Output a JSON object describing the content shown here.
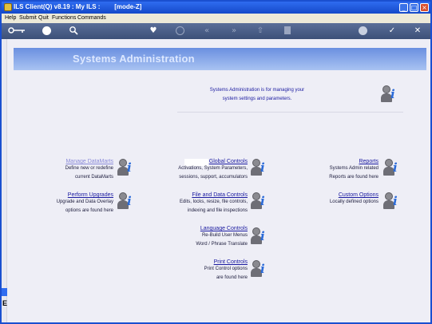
{
  "window": {
    "title": "ILS Client(Q) v8.19 : My ILS :        [mode-Z]",
    "minimize_glyph": "_",
    "maximize_glyph": "□",
    "close_glyph": "×"
  },
  "menu": [
    "Help",
    "Submit",
    "Quit",
    "Functions",
    "Commands"
  ],
  "toolbar": {
    "icons": [
      "key-icon",
      "help-icon",
      "search-icon",
      "heart-icon",
      "refresh-icon",
      "first-icon",
      "last-icon",
      "up-icon",
      "save-icon",
      "settings-icon",
      "confirm-icon",
      "cancel-icon"
    ],
    "glyphs": {
      "help": "?",
      "first": "«",
      "last": "»",
      "up": "⇧",
      "confirm": "✓",
      "cancel": "✕",
      "heart": "♥"
    }
  },
  "banner": {
    "title": "Systems Administration"
  },
  "intro": {
    "line1": "Systems Administration is for managing your",
    "line2": "system settings and parameters."
  },
  "modules": {
    "manage_datamarts": {
      "title": "Manage DataMarts",
      "desc1": "Define new or redefine",
      "desc2": "current DataMarts"
    },
    "perform_upgrades": {
      "title": "Perform Upgrades",
      "desc1": "Upgrade and Data Overlay",
      "desc2": "options are found here"
    },
    "global_controls": {
      "title": "Global Controls",
      "desc1": "Activations, System Parameters,",
      "desc2": "sessions, support, accumulators"
    },
    "file_data_controls": {
      "title": "File and Data Controls",
      "desc1": "Edits, locks, resize, file controls,",
      "desc2": "indexing and file inspections"
    },
    "language_controls": {
      "title": "Language Controls",
      "desc1": "Re-Build User Menus",
      "desc2": "Word / Phrase Translate"
    },
    "print_controls": {
      "title": "Print Controls",
      "desc1": "Print Control options",
      "desc2": "are found here"
    },
    "reports": {
      "title": "Reports",
      "desc1": "Systems Admin related",
      "desc2": "Reports are found here"
    },
    "custom_options": {
      "title": "Custom Options",
      "desc1": "Locally defined options"
    }
  },
  "sidebar": {
    "glyph": "E"
  },
  "helper_glyph": "i",
  "colors": {
    "title_bar": "#1449c9",
    "toolbar": "#4a5e88",
    "banner": "#7a9be4",
    "link": "#1a1aa0"
  }
}
